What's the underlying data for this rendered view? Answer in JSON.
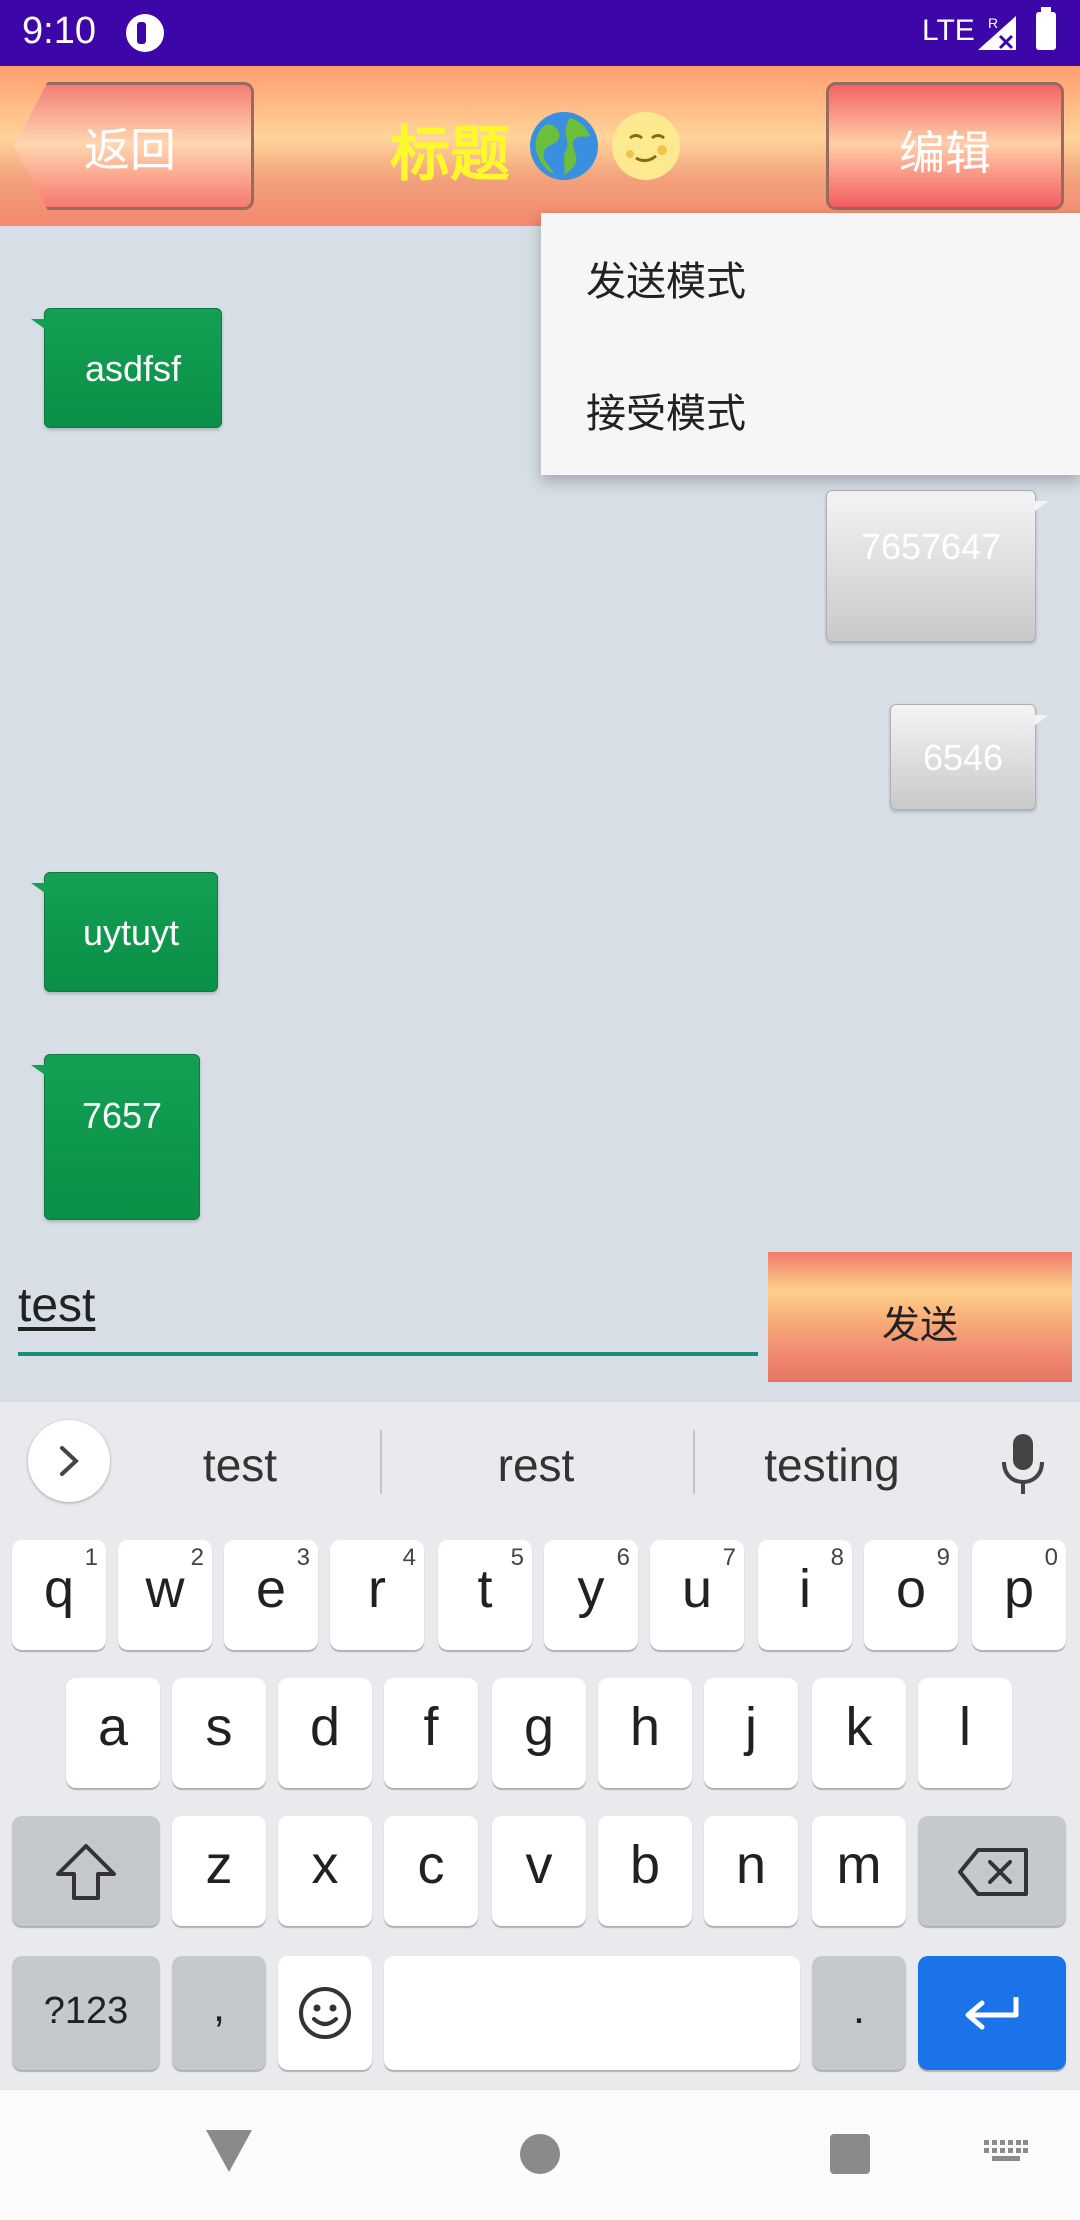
{
  "status_bar": {
    "time": "9:10",
    "network": "LTE"
  },
  "header": {
    "back_label": "返回",
    "title": "标题",
    "edit_label": "编辑"
  },
  "popup_menu": {
    "items": [
      "发送模式",
      "接受模式"
    ]
  },
  "messages": [
    {
      "side": "left",
      "text": "asdfsf"
    },
    {
      "side": "right",
      "text": "7657647"
    },
    {
      "side": "right",
      "text": "6546"
    },
    {
      "side": "left",
      "text": "uytuyt"
    },
    {
      "side": "left",
      "text": "7657"
    }
  ],
  "composer": {
    "input_value": "test",
    "send_label": "发送"
  },
  "keyboard": {
    "suggestions": [
      "test",
      "rest",
      "testing"
    ],
    "row1": [
      {
        "key": "q",
        "sup": "1"
      },
      {
        "key": "w",
        "sup": "2"
      },
      {
        "key": "e",
        "sup": "3"
      },
      {
        "key": "r",
        "sup": "4"
      },
      {
        "key": "t",
        "sup": "5"
      },
      {
        "key": "y",
        "sup": "6"
      },
      {
        "key": "u",
        "sup": "7"
      },
      {
        "key": "i",
        "sup": "8"
      },
      {
        "key": "o",
        "sup": "9"
      },
      {
        "key": "p",
        "sup": "0"
      }
    ],
    "row2": [
      "a",
      "s",
      "d",
      "f",
      "g",
      "h",
      "j",
      "k",
      "l"
    ],
    "row3": [
      "z",
      "x",
      "c",
      "v",
      "b",
      "n",
      "m"
    ],
    "symbols_label": "?123",
    "comma_label": ",",
    "period_label": "."
  },
  "colors": {
    "status_bar": "#3d06a8",
    "title_text": "#fff82c",
    "bubble_left": "#0f9850",
    "bubble_right": "#dcdcdc",
    "input_underline": "#1c8a7f",
    "enter_key": "#1a73e8",
    "chat_background": "#d7dee6"
  },
  "icons": {
    "title_emoji_1": "globe-europe-africa",
    "title_emoji_2": "new-moon-face",
    "nav": [
      "back-triangle",
      "home-circle",
      "recents-square",
      "keyboard-switch"
    ]
  }
}
